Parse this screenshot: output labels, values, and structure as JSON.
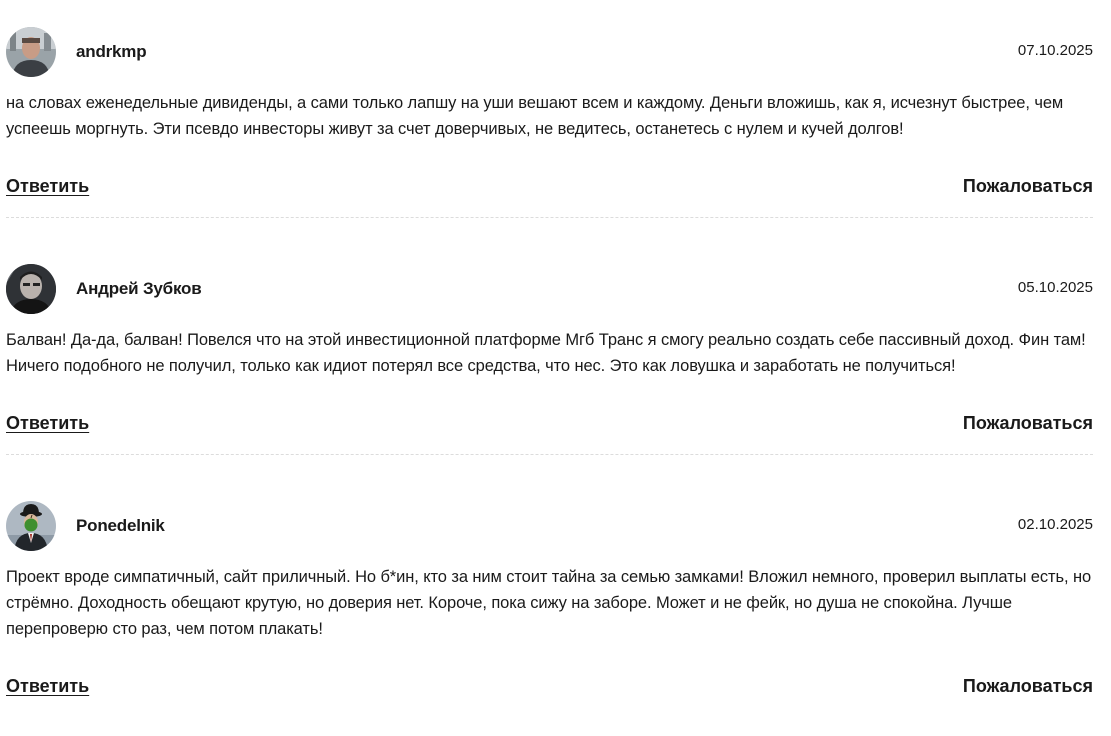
{
  "comments": [
    {
      "author": "andrkmp",
      "date": "07.10.2025",
      "avatar_icon": "user-photo-avatar-icon",
      "text": "на словах еженедельные дивиденды, а сами только лапшу на уши вешают всем и каждому. Деньги вложишь, как я, исчезнут быстрее, чем успеешь моргнуть. Эти псевдо инвесторы живут за счет доверчивых, не ведитесь, останетесь с нулем и кучей долгов!",
      "reply_label": "Ответить",
      "report_label": "Пожаловаться"
    },
    {
      "author": "Андрей Зубков",
      "date": "05.10.2025",
      "avatar_icon": "user-photo-avatar-icon",
      "text": "Балван! Да-да, балван! Повелся что на этой инвестиционной платформе Мгб Транс я смогу реально создать себе пассивный доход. Фин там! Ничего подобного не получил, только как идиот потерял все средства, что нес. Это как ловушка и заработать не получиться!",
      "reply_label": "Ответить",
      "report_label": "Пожаловаться"
    },
    {
      "author": "Ponedelnik",
      "date": "02.10.2025",
      "avatar_icon": "bowler-hat-apple-avatar-icon",
      "text": "Проект вроде симпатичный, сайт приличный. Но б*ин, кто за ним стоит тайна за семью замками! Вложил немного, проверил выплаты есть, но стрёмно. Доходность обещают крутую, но доверия нет. Короче, пока сижу на заборе. Может и не фейк, но душа не спокойна. Лучше перепроверю сто раз, чем потом плакать!",
      "reply_label": "Ответить",
      "report_label": "Пожаловаться"
    }
  ],
  "colors": {
    "text": "#1a1a1a",
    "divider": "#dcdcdc",
    "background": "#ffffff"
  }
}
